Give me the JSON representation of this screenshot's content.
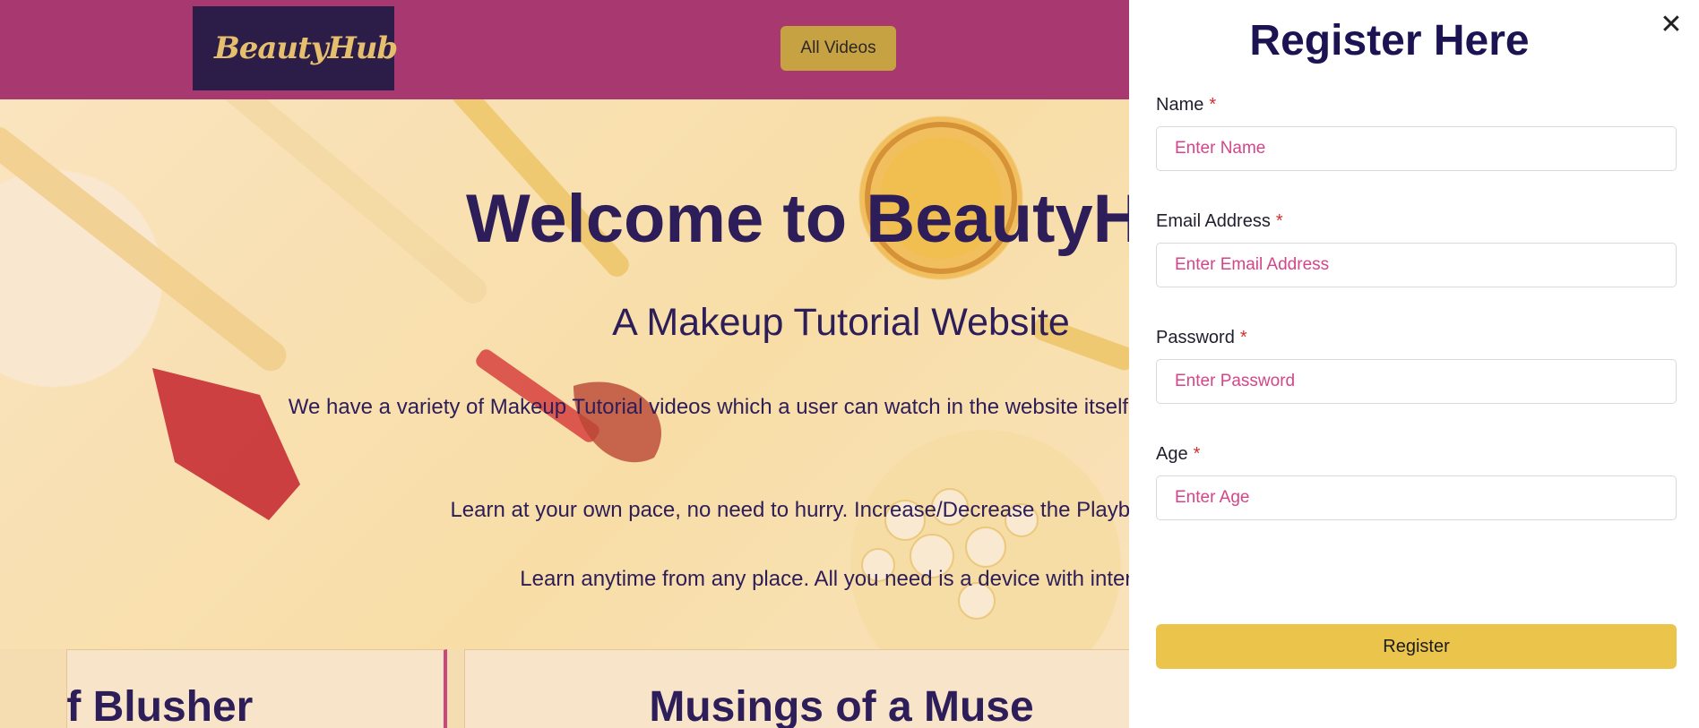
{
  "header": {
    "logo_text": "BeautyHub",
    "nav_button_label": "All Videos"
  },
  "hero": {
    "title": "Welcome to BeautyH",
    "subtitle": "A Makeup Tutorial Website",
    "paragraph_1": "We have a variety of Makeup Tutorial videos which a user can watch in the website itself. No ne tabs to watch video.",
    "paragraph_2": "Learn at your own pace, no need to hurry. Increase/Decrease the Playback Speed",
    "paragraph_3": "Learn anytime from any place. All you need is a device with internet"
  },
  "cards": [
    {
      "title": "of Blusher"
    },
    {
      "title": "Musings of a Muse"
    }
  ],
  "register_panel": {
    "title": "Register Here",
    "close_symbol": "✕",
    "fields": {
      "name": {
        "label": "Name",
        "required_mark": "*",
        "placeholder": "Enter Name"
      },
      "email": {
        "label": "Email Address",
        "required_mark": "*",
        "placeholder": "Enter Email Address"
      },
      "password": {
        "label": "Password",
        "required_mark": "*",
        "placeholder": "Enter Password"
      },
      "age": {
        "label": "Age",
        "required_mark": "*",
        "placeholder": "Enter Age"
      }
    },
    "submit_label": "Register"
  },
  "colors": {
    "navbar": "#a3326d",
    "logo_bg": "#1a1240",
    "nav_button": "#c6a83a",
    "heading": "#1b1352",
    "placeholder": "#d4458a",
    "required": "#d32f2f",
    "register_button": "#ebc54b"
  },
  "icons": {
    "close": "close-icon",
    "logo_mark": "lipstick-mascara-icon"
  }
}
